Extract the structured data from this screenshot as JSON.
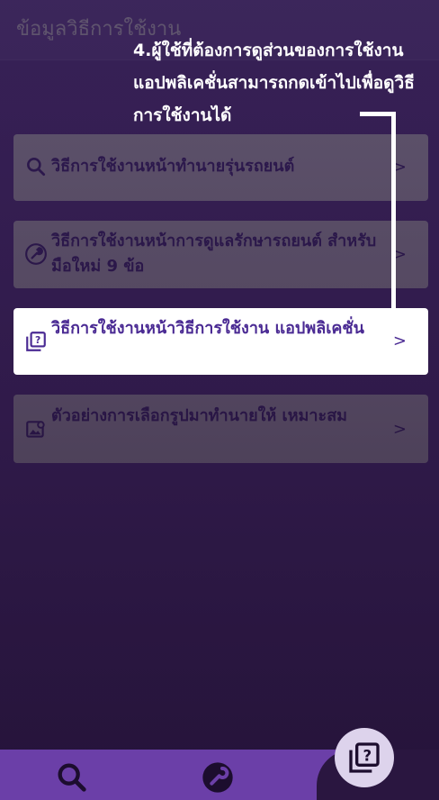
{
  "header": {
    "title": "ข้อมูลวิธีการใช้งาน"
  },
  "menu": [
    {
      "label": "วิธีการใช้งานหน้าทำนายรุ่นรถยนต์",
      "icon": "search-icon",
      "chevron": ">"
    },
    {
      "label": "วิธีการใช้งานหน้าการดูแลรักษารถยนต์ สำหรับมือใหม่ 9 ข้อ",
      "icon": "wrench-icon",
      "chevron": ">"
    },
    {
      "label": "วิธีการใช้งานหน้าวิธีการใช้งาน แอปพลิเคชั่น",
      "icon": "help-pages-icon",
      "chevron": ">"
    },
    {
      "label": "ตัวอย่างการเลือกรูปมาทำนายให้ เหมาะสม",
      "icon": "image-search-icon",
      "chevron": ">"
    }
  ],
  "annotation": {
    "text": "4.ผู้ใช้ที่ต้องการดูส่วนของการใช้งานแอปพลิเคชั่นสามารถกดเข้าไปเพื่อดูวิธีการใช้งานได้"
  },
  "bottom_nav": [
    {
      "icon": "search-icon"
    },
    {
      "icon": "wrench-icon"
    },
    {
      "icon": "help-pages-icon"
    }
  ],
  "colors": {
    "accent": "#6a3fa8",
    "text_accent": "#4a2a93"
  }
}
